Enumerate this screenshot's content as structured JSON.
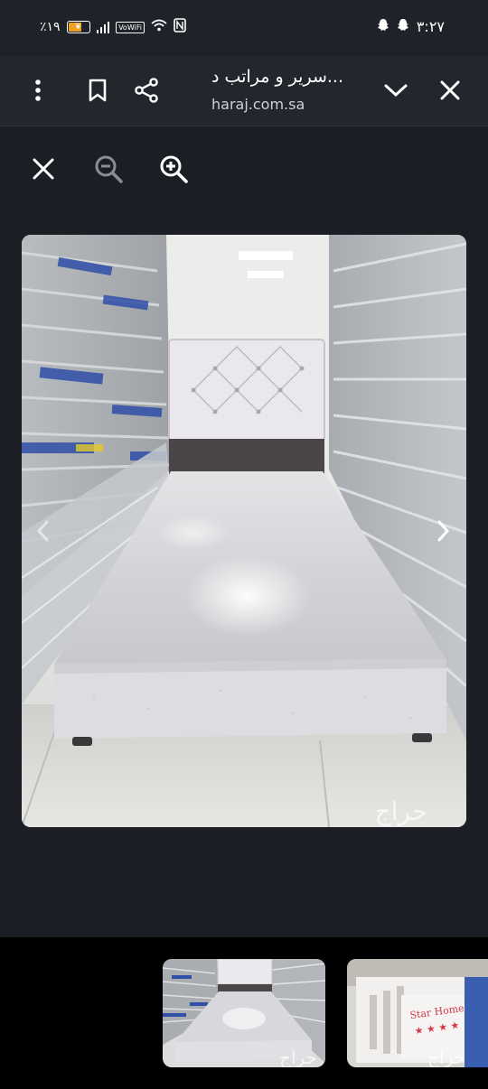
{
  "status_bar": {
    "battery_text": "٪١٩",
    "network_label": "VoWiFi",
    "time": "٣:٢٧"
  },
  "toolbar": {
    "title": "سرير و مراتب د...",
    "url": "haraj.com.sa"
  },
  "icons": {
    "more": "more-vertical-icon",
    "bookmark": "bookmark-icon",
    "share": "share-icon",
    "collapse": "chevron-down-icon",
    "close": "close-icon",
    "viewer_close": "close-icon",
    "zoom_out": "zoom-out-icon",
    "zoom_in": "zoom-in-icon",
    "prev": "chevron-left-icon",
    "next": "chevron-right-icon"
  },
  "watermark": "حراج",
  "thumb_watermark": "حراج",
  "thumb_label_2": "Star Home",
  "colors": {
    "background": "#1b1e24",
    "toolbar": "#22262d",
    "strip": "#000000"
  }
}
